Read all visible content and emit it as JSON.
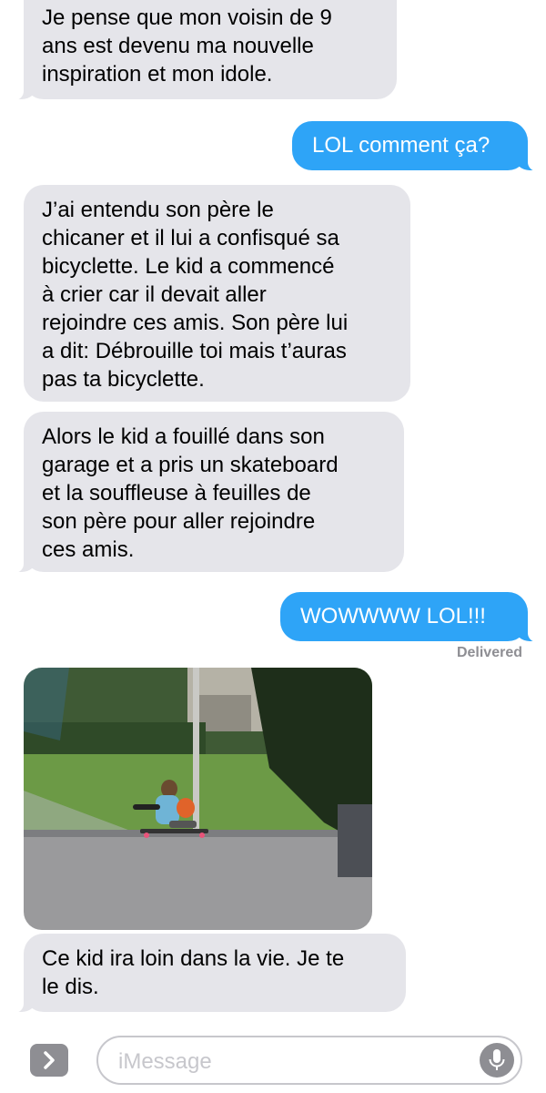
{
  "messages": [
    {
      "direction": "incoming",
      "text": "Je pense que mon voisin de 9\nans est devenu ma nouvelle\ninspiration et mon idole."
    },
    {
      "direction": "outgoing",
      "text": "LOL comment ça?"
    },
    {
      "direction": "incoming",
      "text": "J’ai entendu son père le\nchicaner et il lui a confisqué sa\nbicyclette. Le kid a commencé\nà crier car il devait aller\nrejoindre ces amis. Son père lui\na dit: Débrouille toi mais t’auras\npas ta bicyclette."
    },
    {
      "direction": "incoming",
      "text": "Alors le kid a fouillé dans son\ngarage et a pris un skateboard\net la souffleuse à feuilles de\nson père pour aller rejoindre\nces amis."
    },
    {
      "direction": "outgoing",
      "text": "WOWWWW LOL!!!"
    },
    {
      "direction": "incoming",
      "text": "Ce kid ira loin dans la vie. Je te\nle dis."
    }
  ],
  "delivered_status": "Delivered",
  "photo": {
    "icon": "photo-kid-skateboard-leaf-blower"
  },
  "compose": {
    "placeholder": "iMessage",
    "value": ""
  },
  "colors": {
    "incoming_bubble": "#e5e5ea",
    "outgoing_bubble": "#2ea4f7",
    "meta_text": "#8e8e93"
  }
}
